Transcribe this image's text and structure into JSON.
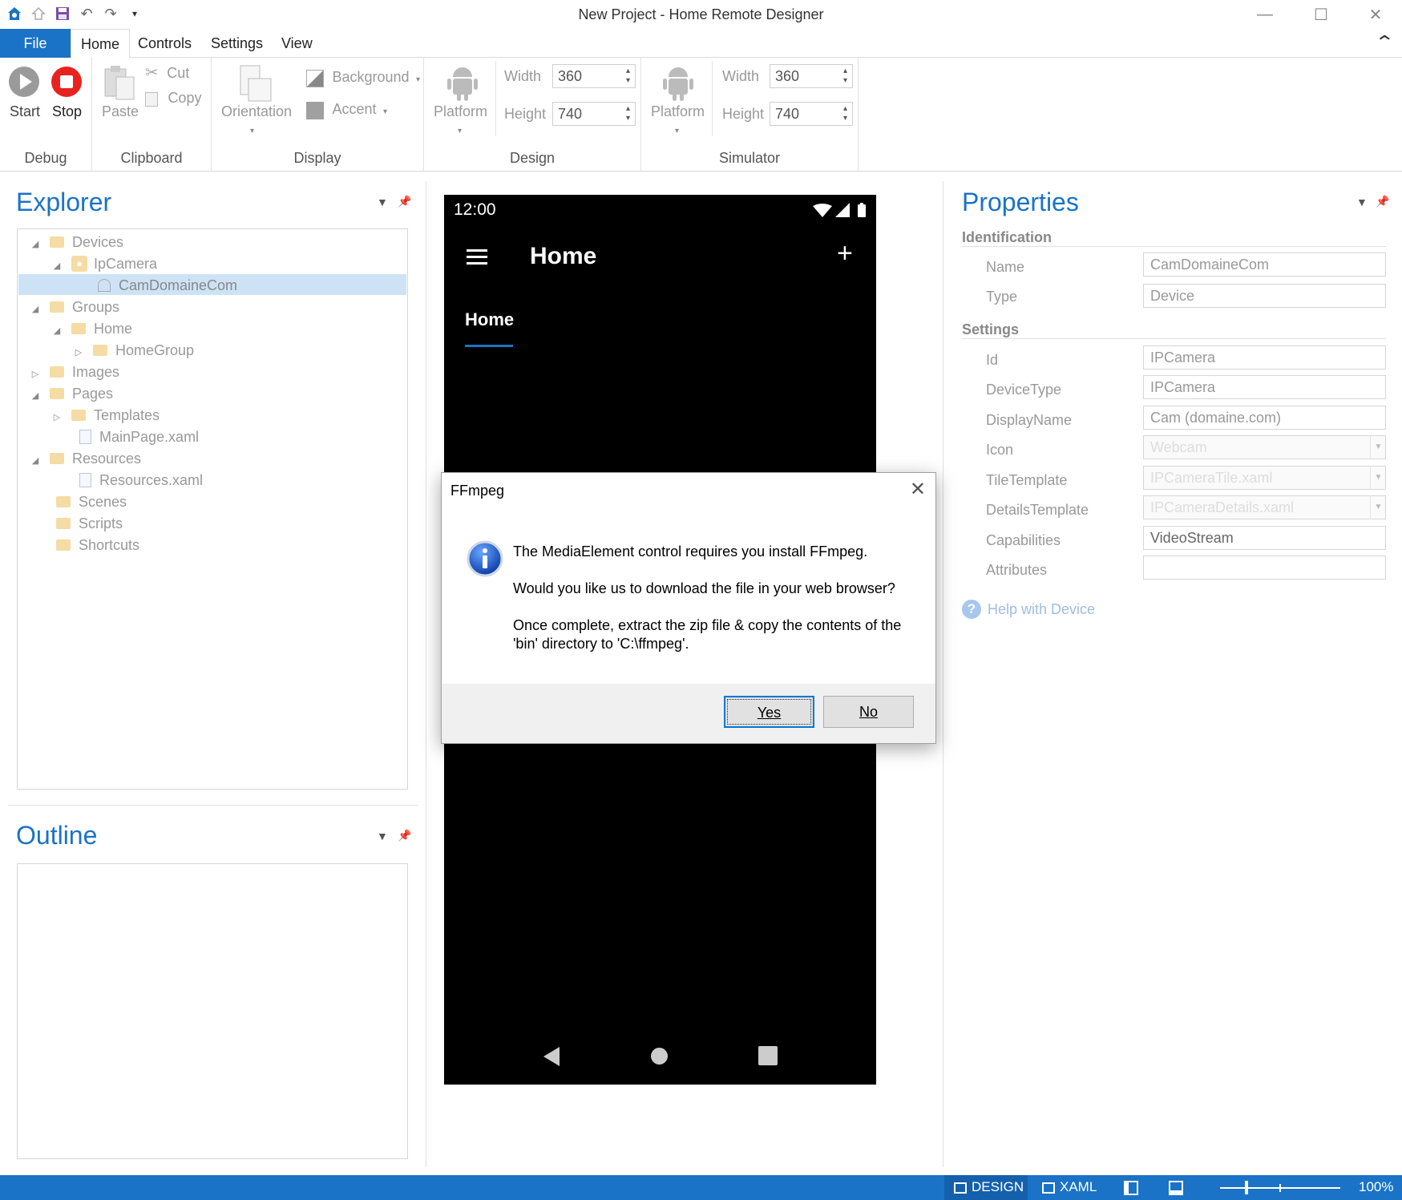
{
  "window": {
    "title": "New Project - Home Remote Designer",
    "controls": {
      "minimize": "—",
      "maximize": "☐",
      "close": "✕"
    }
  },
  "menu": {
    "tabs": [
      {
        "label": "File"
      },
      {
        "label": "Home"
      },
      {
        "label": "Controls"
      },
      {
        "label": "Settings"
      },
      {
        "label": "View"
      }
    ],
    "collapse_glyph": "⌃"
  },
  "ribbon": {
    "debug": {
      "group": "Debug",
      "start": "Start",
      "stop": "Stop"
    },
    "clipboard": {
      "group": "Clipboard",
      "paste": "Paste",
      "cut": "Cut",
      "copy": "Copy"
    },
    "display": {
      "group": "Display",
      "orientation": "Orientation",
      "background": "Background",
      "accent": "Accent"
    },
    "design": {
      "group": "Design",
      "platform": "Platform",
      "width_label": "Width",
      "width": "360",
      "height_label": "Height",
      "height": "740"
    },
    "simulator": {
      "group": "Simulator",
      "platform": "Platform",
      "width_label": "Width",
      "width": "360",
      "height_label": "Height",
      "height": "740"
    }
  },
  "explorer": {
    "title": "Explorer",
    "items": [
      {
        "label": "Devices"
      },
      {
        "label": "IpCamera"
      },
      {
        "label": "CamDomaineCom"
      },
      {
        "label": "Groups"
      },
      {
        "label": "Home"
      },
      {
        "label": "HomeGroup"
      },
      {
        "label": "Images"
      },
      {
        "label": "Pages"
      },
      {
        "label": "Templates"
      },
      {
        "label": "MainPage.xaml"
      },
      {
        "label": "Resources"
      },
      {
        "label": "Resources.xaml"
      },
      {
        "label": "Scenes"
      },
      {
        "label": "Scripts"
      },
      {
        "label": "Shortcuts"
      }
    ]
  },
  "outline": {
    "title": "Outline"
  },
  "phone": {
    "time": "12:00",
    "title": "Home",
    "tab": "Home",
    "plus": "+"
  },
  "properties": {
    "title": "Properties",
    "identification": "Identification",
    "settings": "Settings",
    "fields": {
      "name": {
        "label": "Name",
        "value": "CamDomaineCom"
      },
      "type": {
        "label": "Type",
        "value": "Device"
      },
      "id": {
        "label": "Id",
        "value": "IPCamera"
      },
      "devicetype": {
        "label": "DeviceType",
        "value": "IPCamera"
      },
      "displayname": {
        "label": "DisplayName",
        "value": "Cam (domaine.com)"
      },
      "icon": {
        "label": "Icon",
        "value": "Webcam"
      },
      "tiletemplate": {
        "label": "TileTemplate",
        "value": "IPCameraTile.xaml"
      },
      "detailstemplate": {
        "label": "DetailsTemplate",
        "value": "IPCameraDetails.xaml"
      },
      "capabilities": {
        "label": "Capabilities",
        "value": "VideoStream"
      },
      "attributes": {
        "label": "Attributes",
        "value": ""
      }
    },
    "help": "Help with Device"
  },
  "dialog": {
    "title": "FFmpeg",
    "line1": "The MediaElement control requires you install FFmpeg.",
    "line2": "Would you like us to download the file in your web browser?",
    "line3a": "Once complete, extract the zip file & copy the contents of the",
    "line3b": "'bin' directory to 'C:\\ffmpeg'.",
    "yes": "Yes",
    "no": "No"
  },
  "statusbar": {
    "design": "DESIGN",
    "xaml": "XAML",
    "zoom": "100%"
  },
  "colors": {
    "accent": "#1a73c6",
    "stop": "#e8231f",
    "folder": "#f4dca4",
    "selection": "#cde3f5"
  }
}
